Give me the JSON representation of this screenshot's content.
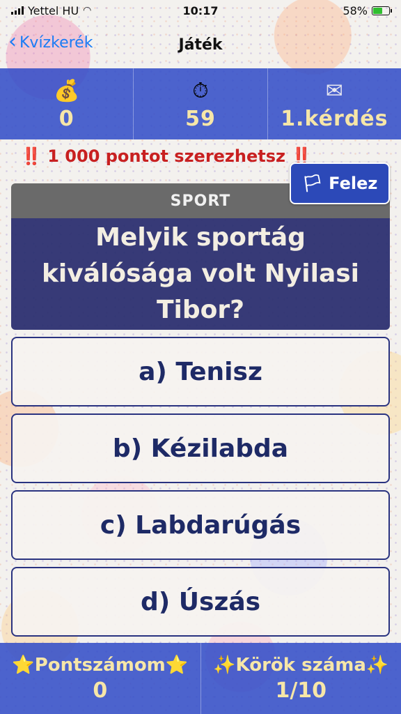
{
  "status_bar": {
    "carrier": "Yettel HU",
    "time": "10:17",
    "battery": "58%",
    "battery_level": 0.58
  },
  "nav": {
    "back_label": "Kvízkerék",
    "title": "Játék"
  },
  "stats": {
    "money_icon": "💰",
    "money_value": "0",
    "timer_icon": "⏱",
    "timer_value": "59",
    "mail_icon": "✉",
    "question_value": "1.kérdés"
  },
  "promo": "‼️ 1 000 pontot szerezhetsz ‼️",
  "halve": {
    "flag": "🏳",
    "label": "Felez"
  },
  "question": {
    "category": "SPORT",
    "text": "Melyik sportág kiválósága volt Nyilasi Tibor?"
  },
  "answers": [
    {
      "label": "a) Tenisz"
    },
    {
      "label": "b) Kézilabda"
    },
    {
      "label": "c) Labdarúgás"
    },
    {
      "label": "d) Úszás"
    }
  ],
  "bottom": {
    "score_label": "⭐Pontszámom⭐",
    "score_value": "0",
    "rounds_label": "✨Körök száma✨",
    "rounds_value": "1/10"
  },
  "colors": {
    "accent_blue": "#344ec8",
    "question_bg": "#282c6e",
    "answer_text": "#1e2a66",
    "promo_red": "#c82020",
    "value_yellow": "#f6e6a8"
  }
}
